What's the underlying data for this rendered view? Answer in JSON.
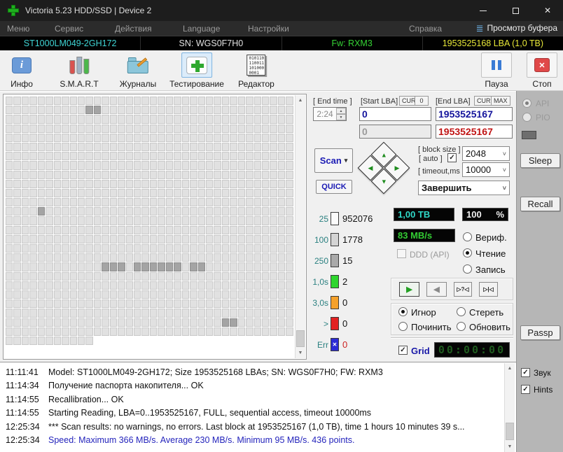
{
  "window": {
    "title": "Victoria 5.23 HDD/SSD | Device 2"
  },
  "icons": {
    "buffer_list": "≣",
    "close": "✕",
    "dropdown": "▾",
    "combo_chevron": "˅",
    "spin_up": "▲",
    "spin_down": "▼",
    "scroll_up": "▲",
    "scroll_down": "▼",
    "dpad_up": "▲",
    "dpad_left": "◀",
    "dpad_right": "▶",
    "dpad_down": "▼",
    "play": "▶",
    "rewind": "◀",
    "seek_question": "▷?◁",
    "seek_end": "▷|◁",
    "check": "✓",
    "err_x": "✕",
    "stop_x": "✕",
    "info_i": "i",
    "doc_lines": [
      "010110",
      "110011",
      "101000",
      "0001"
    ]
  },
  "menu": {
    "items": [
      "Меню",
      "Сервис",
      "Действия",
      "Language",
      "Настройки",
      "Справка"
    ],
    "buffer_view": "Просмотр буфера"
  },
  "info_bar": {
    "model": "ST1000LM049-2GH172",
    "serial": "SN: WGS0F7H0",
    "firmware": "Fw: RXM3",
    "capacity": "1953525168 LBA (1,0 TB)"
  },
  "toolbar": {
    "info": "Инфо",
    "smart": "S.M.A.R.T",
    "journals": "Журналы",
    "testing": "Тестирование",
    "editor": "Редактор",
    "pause": "Пауза",
    "stop": "Стоп"
  },
  "test_panel": {
    "end_time_label": "[ End time ]",
    "end_time_value": "2:24",
    "start_lba_label": "[Start LBA]",
    "cur_label": "CUR",
    "zero_label": "0",
    "start_lba_value": "0",
    "start_lba_secondary": "0",
    "end_lba_label": "[End LBA]",
    "max_label": "MAX",
    "end_lba_value": "1953525167",
    "end_lba_secondary": "1953525167",
    "scan_label": "Scan",
    "quick_label": "QUICK",
    "block_size_label": "[ block size ]",
    "auto_label": "[ auto ]",
    "block_size_value": "2048",
    "timeout_label": "[ timeout,ms ]",
    "timeout_value": "10000",
    "after_action_value": "Завершить"
  },
  "counters": [
    {
      "label": "25",
      "value": "952076",
      "color": "#fbfbfb",
      "is_err": false
    },
    {
      "label": "100",
      "value": "1778",
      "color": "#d4d4d4",
      "is_err": false
    },
    {
      "label": "250",
      "value": "15",
      "color": "#a9a9a9",
      "is_err": false
    },
    {
      "label": "1,0s",
      "value": "2",
      "color": "#2ed62e",
      "is_err": false
    },
    {
      "label": "3,0s",
      "value": "0",
      "color": "#f5a12b",
      "is_err": false
    },
    {
      "label": ">",
      "value": "0",
      "color": "#e32222",
      "is_err": false
    },
    {
      "label": "Err",
      "value": "0",
      "color": "#2b2bd6",
      "is_err": true
    }
  ],
  "status": {
    "capacity": "1,00 TB",
    "percent": "100",
    "percent_unit": "%",
    "speed": "83 MB/s",
    "ddd_label": "DDD (API)",
    "mode_options": [
      "Вериф.",
      "Чтение",
      "Запись"
    ],
    "mode_selected": "Чтение",
    "action_options": [
      "Игнор",
      "Стереть",
      "Починить",
      "Обновить"
    ],
    "action_selected": "Игнор",
    "grid_label": "Grid",
    "timer": "00:00:00"
  },
  "side_panel": {
    "api": "API",
    "pio": "PIO",
    "sleep": "Sleep",
    "recall": "Recall",
    "passp": "Passp",
    "sound": "Звук",
    "hints": "Hints"
  },
  "scan_map": {
    "rows": 27,
    "cols": 36,
    "last_row_cols": 11,
    "dark_cells": [
      [
        1,
        10
      ],
      [
        1,
        11
      ],
      [
        12,
        4
      ],
      [
        18,
        12
      ],
      [
        18,
        13
      ],
      [
        18,
        14
      ],
      [
        18,
        16
      ],
      [
        18,
        17
      ],
      [
        18,
        18
      ],
      [
        18,
        19
      ],
      [
        18,
        20
      ],
      [
        18,
        21
      ],
      [
        18,
        23
      ],
      [
        18,
        24
      ],
      [
        24,
        27
      ],
      [
        24,
        28
      ]
    ]
  },
  "log": [
    {
      "time": "11:11:41",
      "text": "Model: ST1000LM049-2GH172; Size 1953525168 LBAs; SN: WGS0F7H0; FW: RXM3",
      "blue": false
    },
    {
      "time": "11:14:34",
      "text": "Получение паспорта накопителя... OK",
      "blue": false
    },
    {
      "time": "11:14:55",
      "text": "Recallibration... OK",
      "blue": false
    },
    {
      "time": "11:14:55",
      "text": "Starting Reading, LBA=0..1953525167, FULL, sequential access, timeout 10000ms",
      "blue": false
    },
    {
      "time": "12:25:34",
      "text": "*** Scan results: no warnings, no errors. Last block at 1953525167 (1,0 TB), time 1 hours 10 minutes 39 s...",
      "blue": false
    },
    {
      "time": "12:25:34",
      "text": "Speed: Maximum 366 MB/s. Average 230 MB/s. Minimum 95 MB/s. 436 points.",
      "blue": true
    }
  ]
}
